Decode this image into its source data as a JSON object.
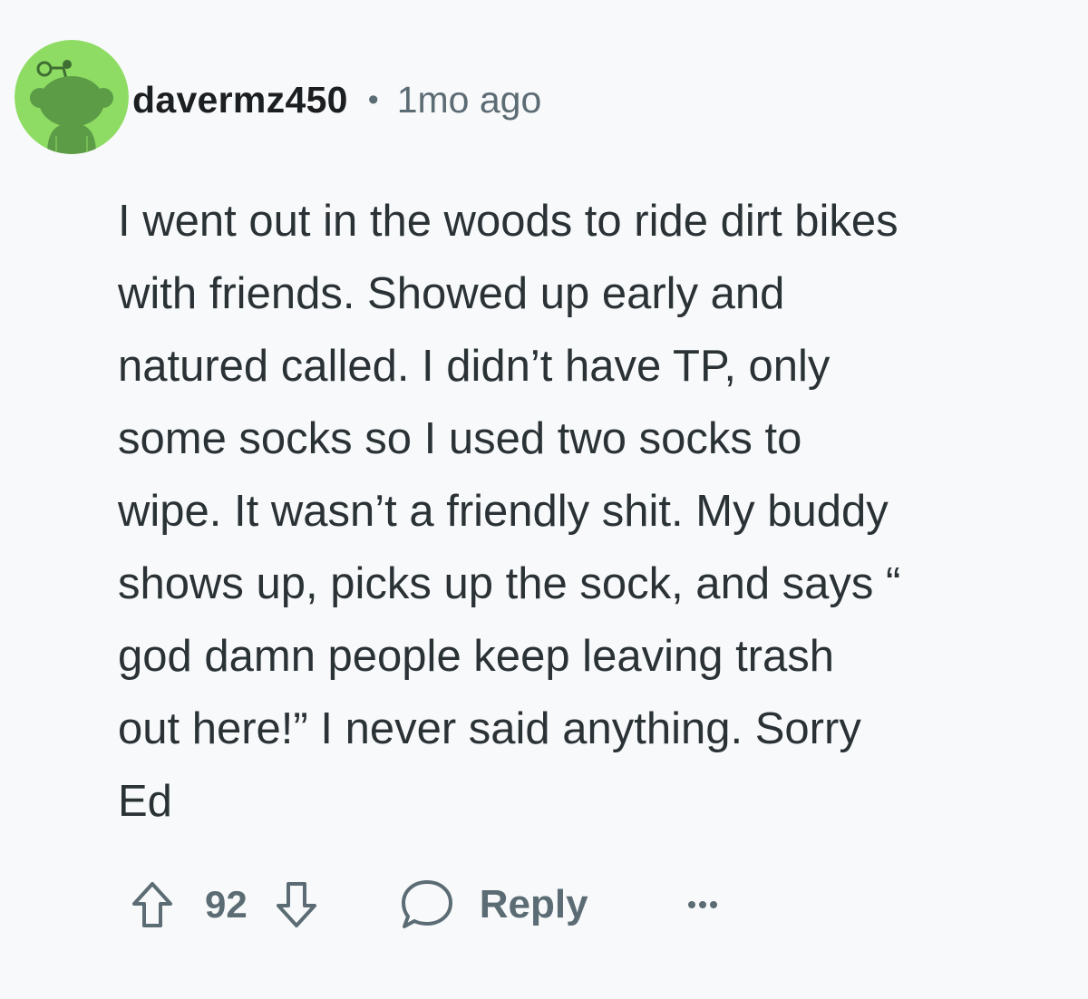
{
  "comment": {
    "author": "davermz450",
    "separator": "•",
    "time_ago": "1mo ago",
    "avatar_icon": "snoo-avatar-icon",
    "body_lines": [
      "I went out in the woods to ride dirt bikes",
      "with friends. Showed up early and",
      "natured called. I didn’t have TP, only",
      "some socks so I used two socks to",
      "wipe. It wasn’t a friendly shit. My buddy",
      "shows up, picks up the sock, and says “",
      "god damn people keep leaving trash",
      "out here!” I never said anything. Sorry",
      "Ed"
    ],
    "score": "92",
    "upvote_icon": "arrow-up-icon",
    "downvote_icon": "arrow-down-icon",
    "reply_icon": "speech-bubble-icon",
    "reply_label": "Reply",
    "more_icon": "ellipsis-icon"
  },
  "colors": {
    "background": "#f8f9fa",
    "avatar_bg": "#8edc63",
    "avatar_figure": "#5c9c47",
    "text_primary": "#2a3236",
    "text_secondary": "#5c6c74"
  }
}
